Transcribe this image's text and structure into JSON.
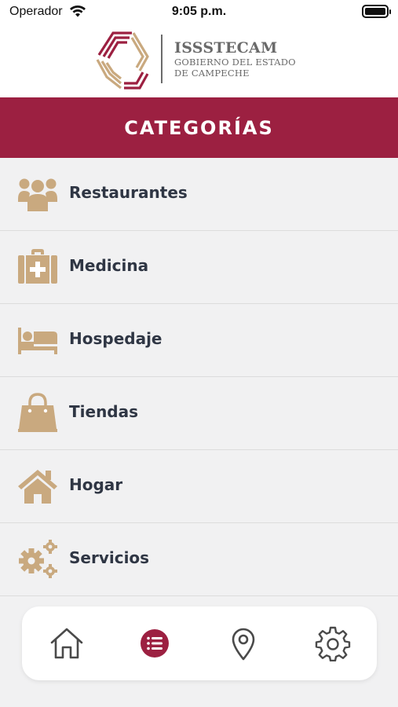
{
  "status_bar": {
    "carrier": "Operador",
    "time": "9:05 p.m."
  },
  "header": {
    "brand_name": "ISSSTECAM",
    "brand_line1": "GOBIERNO DEL ESTADO",
    "brand_line2": "DE CAMPECHE"
  },
  "page": {
    "title": "CATEGORÍAS"
  },
  "categories": [
    {
      "label": "Restaurantes",
      "icon": "users-icon"
    },
    {
      "label": "Medicina",
      "icon": "medkit-icon"
    },
    {
      "label": "Hospedaje",
      "icon": "bed-icon"
    },
    {
      "label": "Tiendas",
      "icon": "shopping-bag-icon"
    },
    {
      "label": "Hogar",
      "icon": "house-icon"
    },
    {
      "label": "Servicios",
      "icon": "gears-icon"
    }
  ],
  "bottom_nav": [
    {
      "icon": "home-icon",
      "active": false
    },
    {
      "icon": "list-icon",
      "active": true
    },
    {
      "icon": "map-pin-icon",
      "active": false
    },
    {
      "icon": "gear-icon",
      "active": false
    }
  ],
  "colors": {
    "brand": "#9c2041",
    "icon_tan": "#c9a97f",
    "text_dark": "#2f3644",
    "background": "#f1f1f2"
  }
}
